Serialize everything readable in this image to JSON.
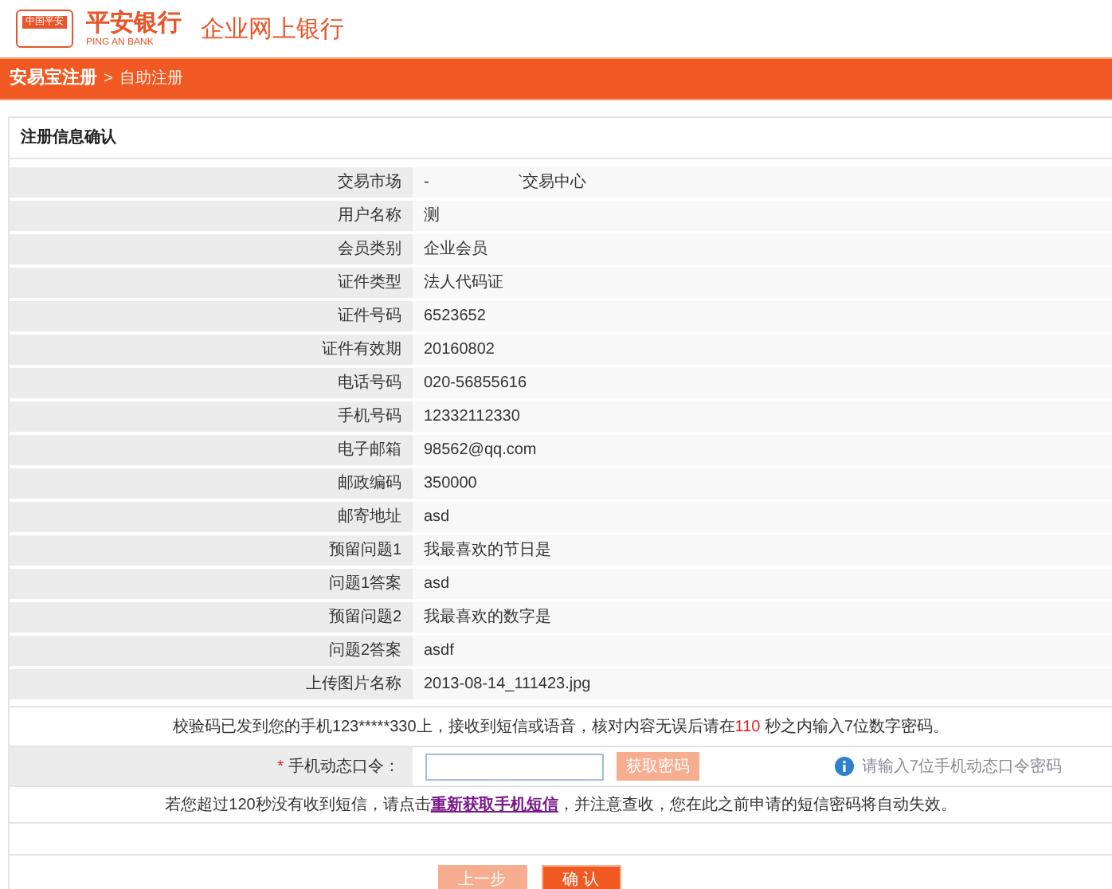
{
  "header": {
    "logo_badge": "中国平安",
    "bank_name": "平安银行",
    "bank_name_en": "PING AN BANK",
    "product": "企业网上银行"
  },
  "breadcrumb": {
    "parent": "安易宝注册",
    "separator": ">",
    "current": "自助注册"
  },
  "panel": {
    "title": "注册信息确认"
  },
  "fields": [
    {
      "label": "交易市场",
      "value": "-                    `交易中心"
    },
    {
      "label": "用户名称",
      "value": "测"
    },
    {
      "label": "会员类别",
      "value": "企业会员"
    },
    {
      "label": "证件类型",
      "value": "法人代码证"
    },
    {
      "label": "证件号码",
      "value": "6523652"
    },
    {
      "label": "证件有效期",
      "value": "20160802"
    },
    {
      "label": "电话号码",
      "value": "020-56855616"
    },
    {
      "label": "手机号码",
      "value": "12332112330"
    },
    {
      "label": "电子邮箱",
      "value": "98562@qq.com"
    },
    {
      "label": "邮政编码",
      "value": "350000"
    },
    {
      "label": "邮寄地址",
      "value": "asd"
    },
    {
      "label": "预留问题1",
      "value": "我最喜欢的节日是"
    },
    {
      "label": "问题1答案",
      "value": "asd"
    },
    {
      "label": "预留问题2",
      "value": "我最喜欢的数字是"
    },
    {
      "label": "问题2答案",
      "value": "asdf"
    },
    {
      "label": "上传图片名称",
      "value": "2013-08-14_111423.jpg"
    }
  ],
  "sms_notice": {
    "before": "校验码已发到您的手机123*****330上，接收到短信或语音，核对内容无误后请在",
    "seconds": "110",
    "after": "秒之内输入7位数字密码。"
  },
  "code_row": {
    "required_mark": "*",
    "label": "手机动态口令：",
    "get_code_button": {
      "label": "获取密码",
      "disabled": true
    },
    "hint": "请输入7位手机动态口令密码"
  },
  "resend_notice": {
    "before": "若您超过120秒没有收到短信，请点击",
    "link": "重新获取手机短信",
    "after": "，并注意查收，您在此之前申请的短信密码将自动失效。"
  },
  "buttons": [
    {
      "label": "上一步",
      "kind": "secondary"
    },
    {
      "label": "确 认",
      "kind": "primary"
    }
  ]
}
